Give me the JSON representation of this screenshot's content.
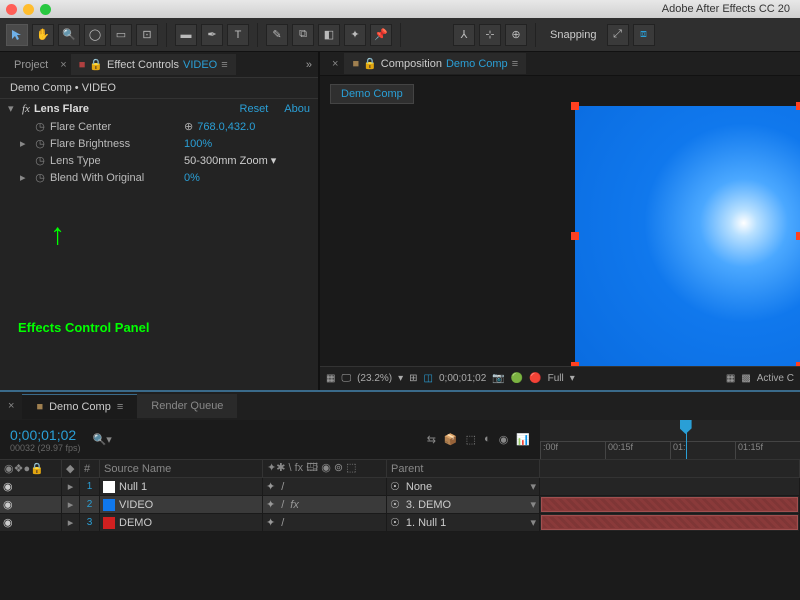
{
  "app": {
    "title": "Adobe After Effects CC 20"
  },
  "toolbar": {
    "snapping_label": "Snapping"
  },
  "left_panel": {
    "project_tab": "Project",
    "effect_controls_label": "Effect Controls",
    "effect_controls_target": "VIDEO",
    "breadcrumb": "Demo Comp • VIDEO",
    "effect": {
      "name": "Lens Flare",
      "reset": "Reset",
      "about": "Abou",
      "props": [
        {
          "name": "Flare Center",
          "value": "768.0,432.0",
          "has_arrow": false,
          "has_target": true
        },
        {
          "name": "Flare Brightness",
          "value": "100%",
          "has_arrow": true,
          "link": true
        },
        {
          "name": "Lens Type",
          "value": "50-300mm Zoom ▾",
          "has_arrow": false,
          "plain": true
        },
        {
          "name": "Blend With Original",
          "value": "0%",
          "has_arrow": true,
          "link": true
        }
      ]
    },
    "annotation": "Effects Control Panel"
  },
  "comp_panel": {
    "label": "Composition",
    "name": "Demo Comp",
    "nested_tab": "Demo Comp",
    "footer": {
      "zoom": "(23.2%)",
      "timecode": "0;00;01;02",
      "res": "Full",
      "view": "Active C"
    }
  },
  "timeline": {
    "tabs": {
      "comp": "Demo Comp",
      "render": "Render Queue"
    },
    "timecode": "0;00;01;02",
    "timecode_sub": "00032 (29.97 fps)",
    "ruler": [
      ":00f",
      "00:15f",
      "01:",
      "01:15f"
    ],
    "columns": {
      "source_name": "Source Name",
      "parent": "Parent",
      "num": "#"
    },
    "layers": [
      {
        "num": "1",
        "name": "Null 1",
        "color": "#ffffff",
        "parent": "None",
        "selected": false
      },
      {
        "num": "2",
        "name": "VIDEO",
        "color": "#1078ed",
        "parent": "3. DEMO",
        "selected": true
      },
      {
        "num": "3",
        "name": "DEMO",
        "color": "#d02020",
        "parent": "1. Null 1",
        "selected": false
      }
    ]
  }
}
